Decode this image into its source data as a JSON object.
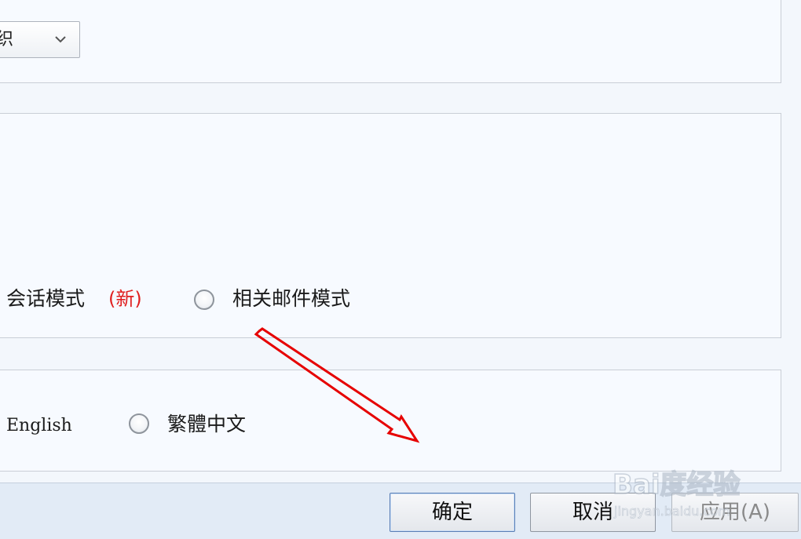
{
  "settings": {
    "dropdown": {
      "value": "织"
    },
    "view_mode": {
      "options": [
        {
          "label": "会话模式",
          "tag": "(新)"
        },
        {
          "label": "相关邮件模式"
        }
      ]
    },
    "language": {
      "options": [
        {
          "label": "English"
        },
        {
          "label": "繁體中文"
        }
      ]
    }
  },
  "footer": {
    "ok_label": "确定",
    "cancel_label": "取消",
    "apply_label": "应用(A)"
  },
  "watermark": {
    "brand": "Bai度经验",
    "url": "jingyan.baidu.com"
  },
  "colors": {
    "new_tag": "#e02020",
    "annotation_arrow": "#e60000",
    "primary_button_border": "#5a7fb5"
  }
}
